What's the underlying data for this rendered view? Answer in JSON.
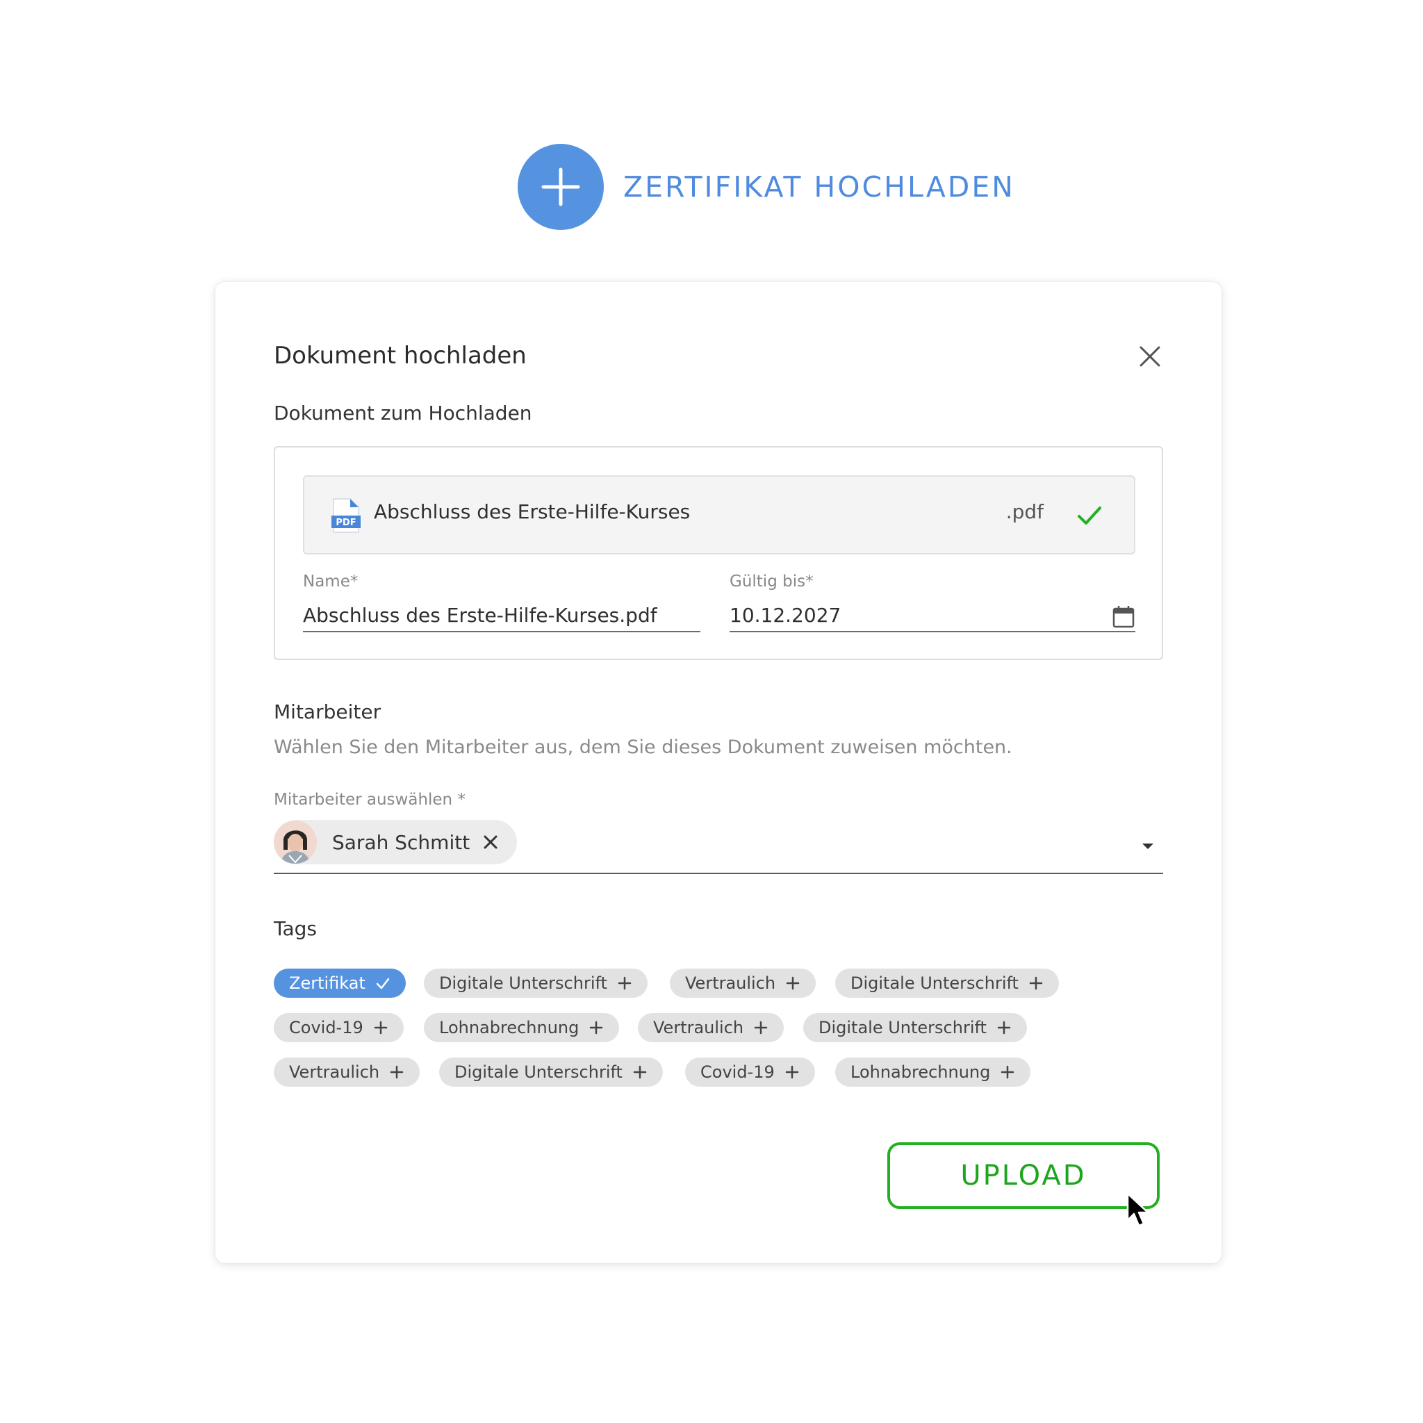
{
  "cta": {
    "label": "ZERTIFIKAT HOCHLADEN",
    "icon": "plus-icon",
    "color": "#5592e0"
  },
  "dialog": {
    "title": "Dokument hochladen",
    "close_icon": "close-icon"
  },
  "document": {
    "section_label": "Dokument zum Hochladen",
    "file_icon": "pdf-file-icon",
    "file_icon_text": "PDF",
    "file_name": "Abschluss des Erste-Hilfe-Kurses",
    "file_ext": ".pdf",
    "status_icon": "check-icon",
    "name_label": "Name*",
    "name_value": "Abschluss des Erste-Hilfe-Kurses.pdf",
    "valid_label": "Gültig bis*",
    "valid_value": "10.12.2027",
    "calendar_icon": "calendar-icon"
  },
  "employee": {
    "section_label": "Mitarbeiter",
    "helper": "Wählen Sie den Mitarbeiter aus, dem Sie dieses Dokument zuweisen möchten.",
    "select_label": "Mitarbeiter auswählen *",
    "selected_name": "Sarah Schmitt",
    "dropdown_icon": "chevron-down-icon"
  },
  "tags": {
    "section_label": "Tags",
    "items": [
      {
        "label": "Zertifikat",
        "selected": true
      },
      {
        "label": "Digitale Unterschrift",
        "selected": false
      },
      {
        "label": "Vertraulich",
        "selected": false
      },
      {
        "label": "Digitale Unterschrift",
        "selected": false
      },
      {
        "label": "Covid-19",
        "selected": false
      },
      {
        "label": "Lohnabrechnung",
        "selected": false
      },
      {
        "label": "Vertraulich",
        "selected": false
      },
      {
        "label": "Digitale Unterschrift",
        "selected": false
      },
      {
        "label": "Vertraulich",
        "selected": false
      },
      {
        "label": "Digitale Unterschrift",
        "selected": false
      },
      {
        "label": "Covid-19",
        "selected": false
      },
      {
        "label": "Lohnabrechnung",
        "selected": false
      }
    ]
  },
  "actions": {
    "upload_label": "UPLOAD",
    "upload_color": "#22b022"
  }
}
